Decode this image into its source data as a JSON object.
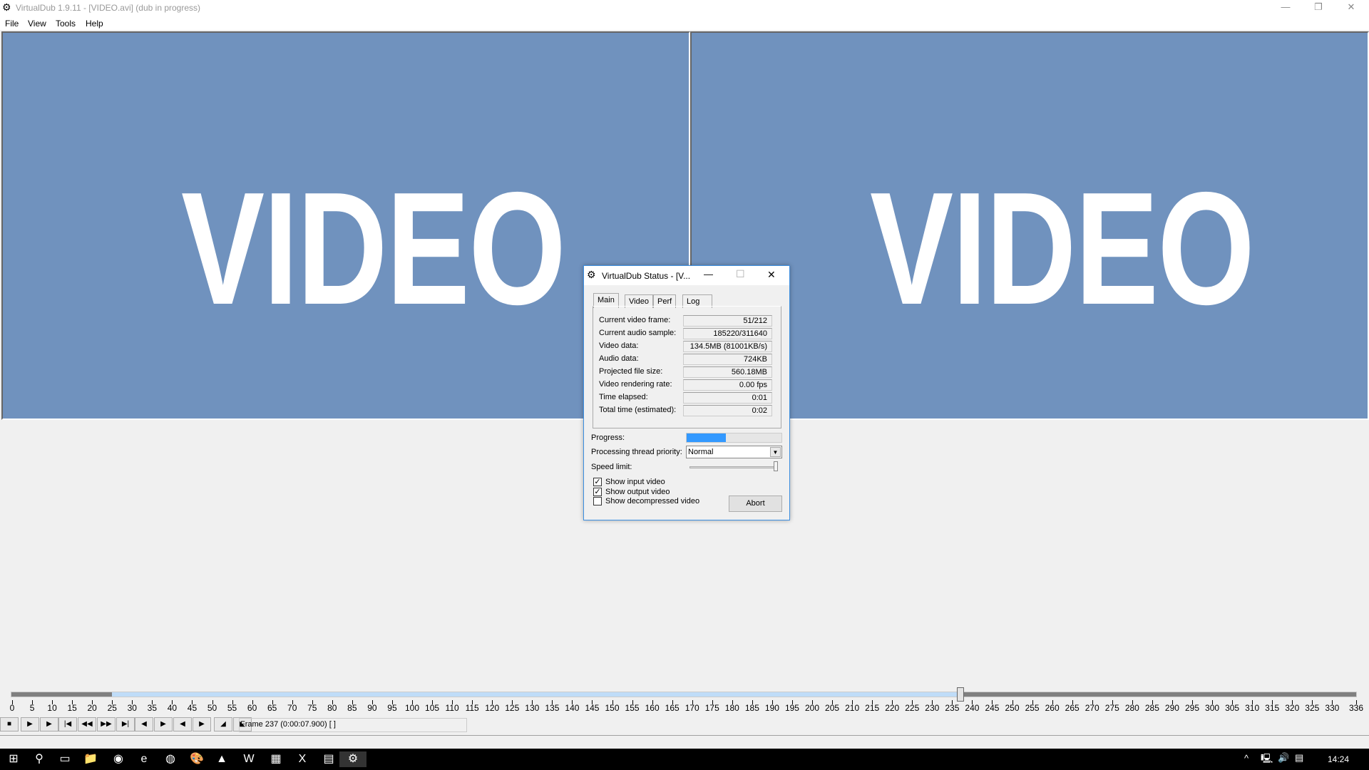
{
  "window": {
    "title": "VirtualDub 1.9.11 - [VIDEO.avi] (dub in progress)",
    "icon": "virtualdub-gear-icon"
  },
  "menu": [
    "File",
    "View",
    "Tools",
    "Help"
  ],
  "panes": {
    "input_text": "VIDEO",
    "output_text": "VIDEO",
    "background": "#7092be"
  },
  "dialog": {
    "title": "VirtualDub Status - [V...",
    "tabs": [
      "Main",
      "Video",
      "Perf",
      "Log"
    ],
    "active_tab": "Main",
    "rows": [
      {
        "label": "Current video frame:",
        "value": "51/212"
      },
      {
        "label": "Current audio sample:",
        "value": "185220/311640"
      },
      {
        "label": "Video data:",
        "value": "134.5MB (81001KB/s)"
      },
      {
        "label": "Audio data:",
        "value": "724KB"
      },
      {
        "label": "Projected file size:",
        "value": "560.18MB"
      },
      {
        "label": "Video rendering rate:",
        "value": "0.00 fps"
      },
      {
        "label": "Time elapsed:",
        "value": "0:01"
      },
      {
        "label": "Total time (estimated):",
        "value": "0:02"
      }
    ],
    "progress_label": "Progress:",
    "progress_fraction": 0.41,
    "progress_color": "#3399ff",
    "priority_label": "Processing thread priority:",
    "priority_value": "Normal",
    "speed_label": "Speed limit:",
    "speed_fraction": 1.0,
    "checkboxes": [
      {
        "label": "Show input video",
        "checked": true
      },
      {
        "label": "Show output video",
        "checked": true
      },
      {
        "label": "Show decompressed video",
        "checked": false
      }
    ],
    "abort_label": "Abort"
  },
  "timeline": {
    "min": 0,
    "max": 336,
    "tick_step": 5,
    "current_frame": 237,
    "selection_start": 25,
    "selection_end": 237
  },
  "toolbar": {
    "frame_status": "Frame 237 (0:00:07.900) [ ]"
  },
  "taskbar": {
    "clock": "14:24",
    "apps": [
      "start",
      "search",
      "task-view",
      "file-explorer",
      "chrome",
      "edge",
      "firefox",
      "paint",
      "vlc",
      "word",
      "calculator",
      "excel",
      "notepad",
      "virtualdub"
    ]
  }
}
